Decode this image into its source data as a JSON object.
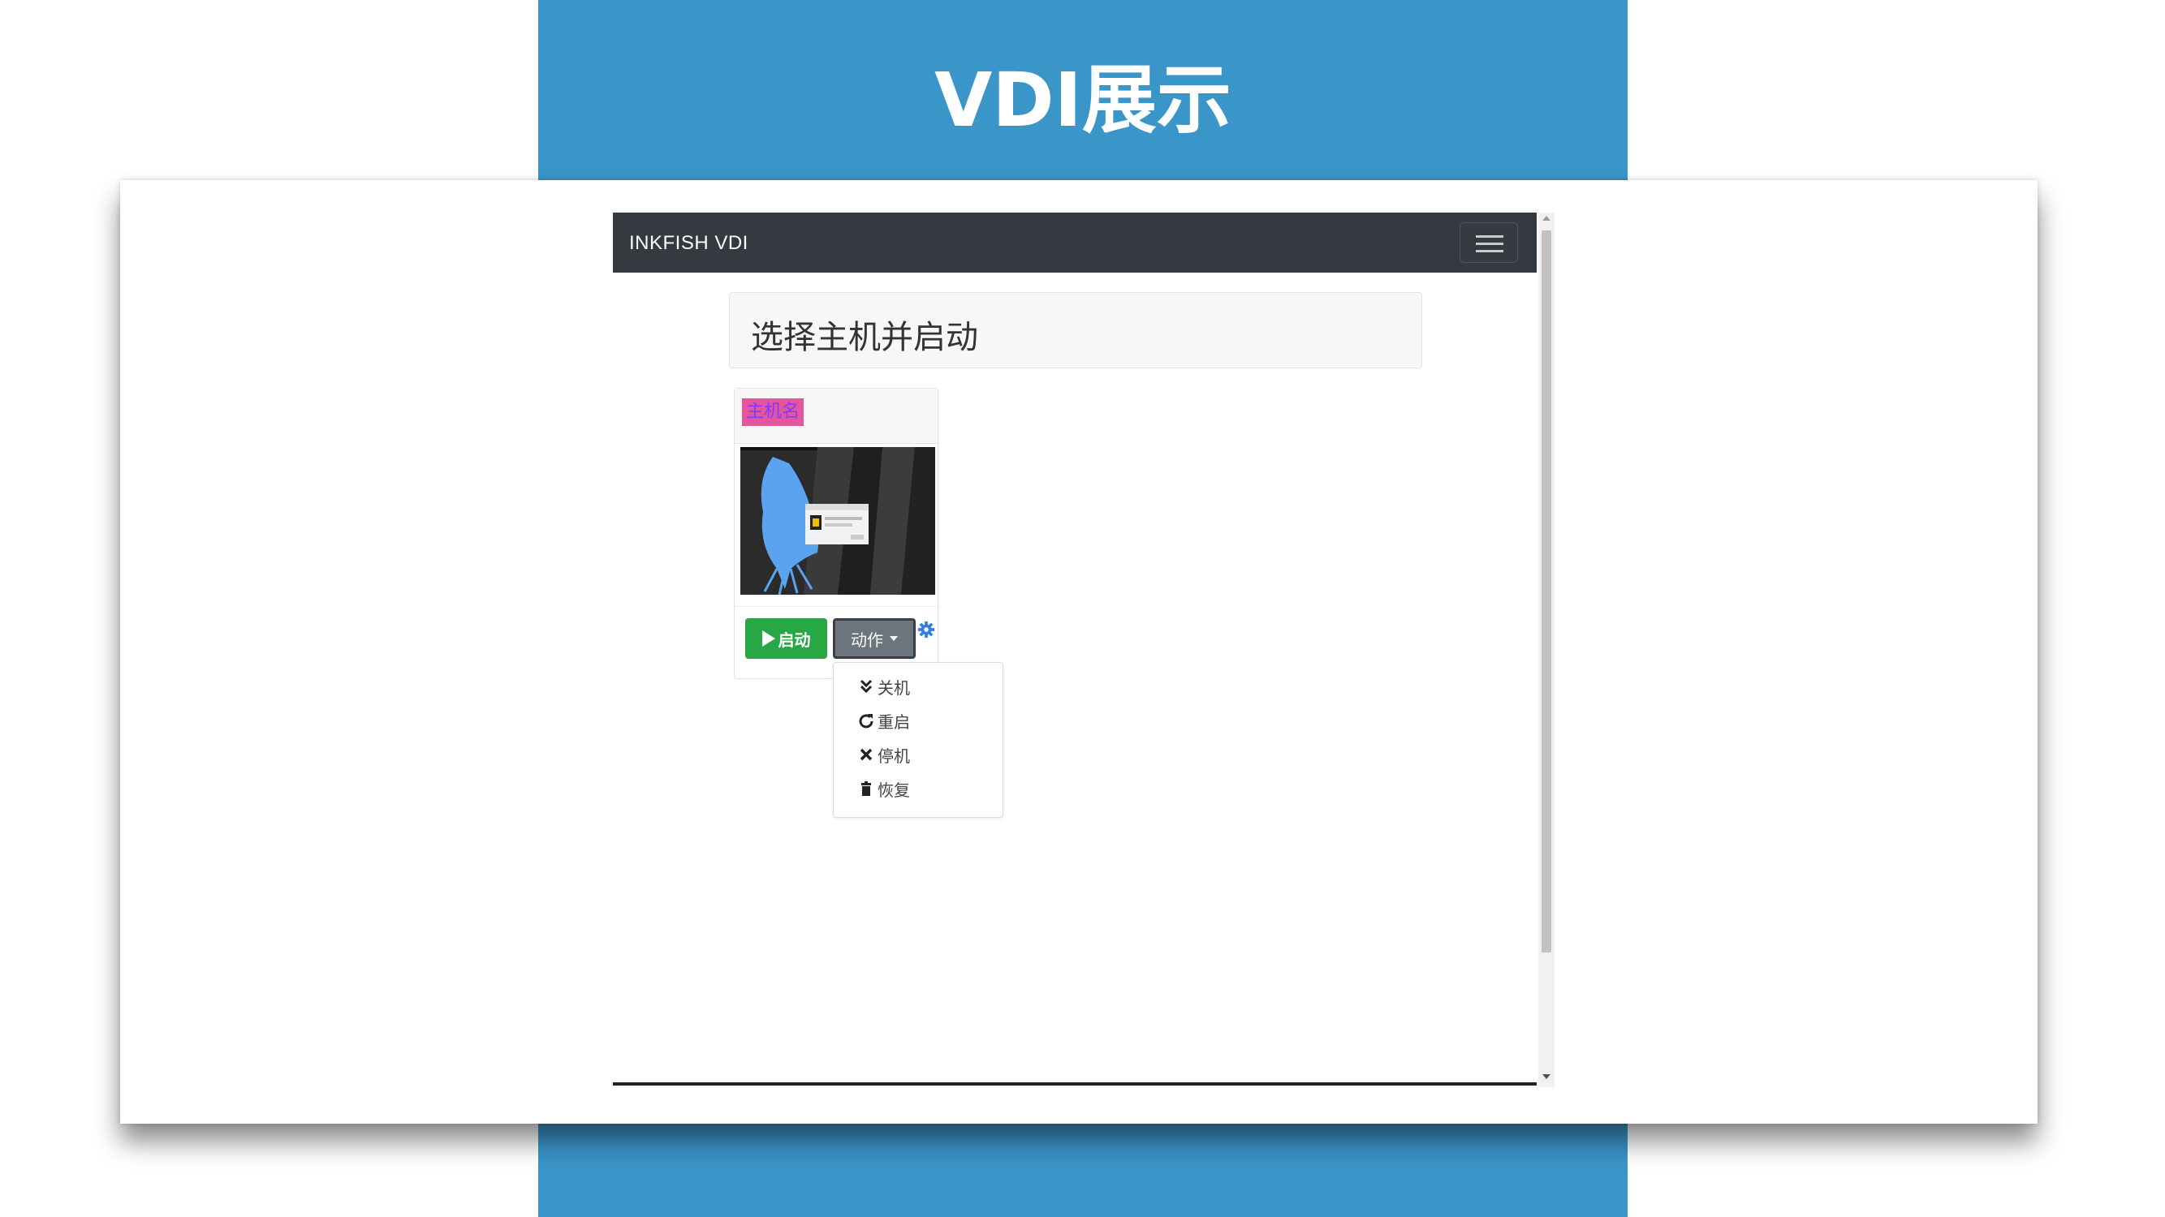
{
  "slide": {
    "title": "VDI展示",
    "accent_color": "#3a95c9"
  },
  "navbar": {
    "brand": "INKFISH VDI",
    "toggler_icon": "hamburger-icon",
    "background": "#343a40"
  },
  "jumbotron": {
    "heading": "选择主机并启动"
  },
  "host_card": {
    "hostname": "主机名",
    "thumbnail": "desktop-screenshot",
    "start_button": "启动",
    "start_icon": "play-icon",
    "action_button": "动作",
    "settings_icon": "gear-icon"
  },
  "action_menu": {
    "items": [
      {
        "label": "关机",
        "icon": "double-chevron-down-icon"
      },
      {
        "label": "重启",
        "icon": "refresh-icon"
      },
      {
        "label": "停机",
        "icon": "close-icon"
      },
      {
        "label": "恢复",
        "icon": "trash-icon"
      }
    ]
  }
}
